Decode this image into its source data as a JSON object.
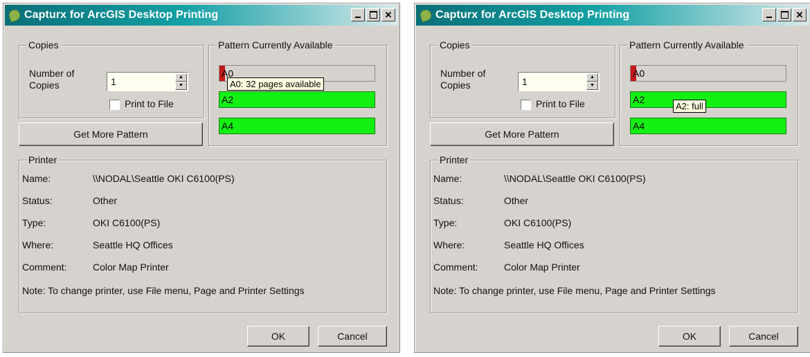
{
  "windows": [
    {
      "title": "Capturx for ArcGIS Desktop Printing",
      "copies": {
        "group_label": "Copies",
        "number_label": "Number of Copies",
        "number_value": "1",
        "print_to_file_label": "Print to File",
        "print_to_file_checked": false
      },
      "get_more_label": "Get More Pattern",
      "pattern": {
        "group_label": "Pattern Currently Available",
        "items": [
          {
            "label": "A0",
            "level": 0.03,
            "color": "#c41818"
          },
          {
            "label": "A2",
            "level": 1.0,
            "color": "#14f014"
          },
          {
            "label": "A4",
            "level": 1.0,
            "color": "#14f014"
          }
        ]
      },
      "tooltip": "A0: 32 pages available",
      "printer": {
        "group_label": "Printer",
        "name_key": "Name:",
        "name_value": "\\\\NODAL\\Seattle OKI C6100(PS)",
        "status_key": "Status:",
        "status_value": "Other",
        "type_key": "Type:",
        "type_value": "OKI C6100(PS)",
        "where_key": "Where:",
        "where_value": "Seattle HQ Offices",
        "comment_key": "Comment:",
        "comment_value": "Color Map Printer",
        "note": "Note: To change printer, use File menu, Page and Printer Settings"
      },
      "ok_label": "OK",
      "cancel_label": "Cancel"
    },
    {
      "title": "Capturx for ArcGIS Desktop Printing",
      "copies": {
        "group_label": "Copies",
        "number_label": "Number of Copies",
        "number_value": "1",
        "print_to_file_label": "Print to File",
        "print_to_file_checked": false
      },
      "get_more_label": "Get More Pattern",
      "pattern": {
        "group_label": "Pattern Currently Available",
        "items": [
          {
            "label": "A0",
            "level": 0.03,
            "color": "#c41818"
          },
          {
            "label": "A2",
            "level": 1.0,
            "color": "#14f014"
          },
          {
            "label": "A4",
            "level": 1.0,
            "color": "#14f014"
          }
        ]
      },
      "tooltip": "A2: full",
      "printer": {
        "group_label": "Printer",
        "name_key": "Name:",
        "name_value": "\\\\NODAL\\Seattle OKI C6100(PS)",
        "status_key": "Status:",
        "status_value": "Other",
        "type_key": "Type:",
        "type_value": "OKI C6100(PS)",
        "where_key": "Where:",
        "where_value": "Seattle HQ Offices",
        "comment_key": "Comment:",
        "comment_value": "Color Map Printer",
        "note": "Note: To change printer, use File menu, Page and Printer Settings"
      },
      "ok_label": "OK",
      "cancel_label": "Cancel"
    }
  ]
}
